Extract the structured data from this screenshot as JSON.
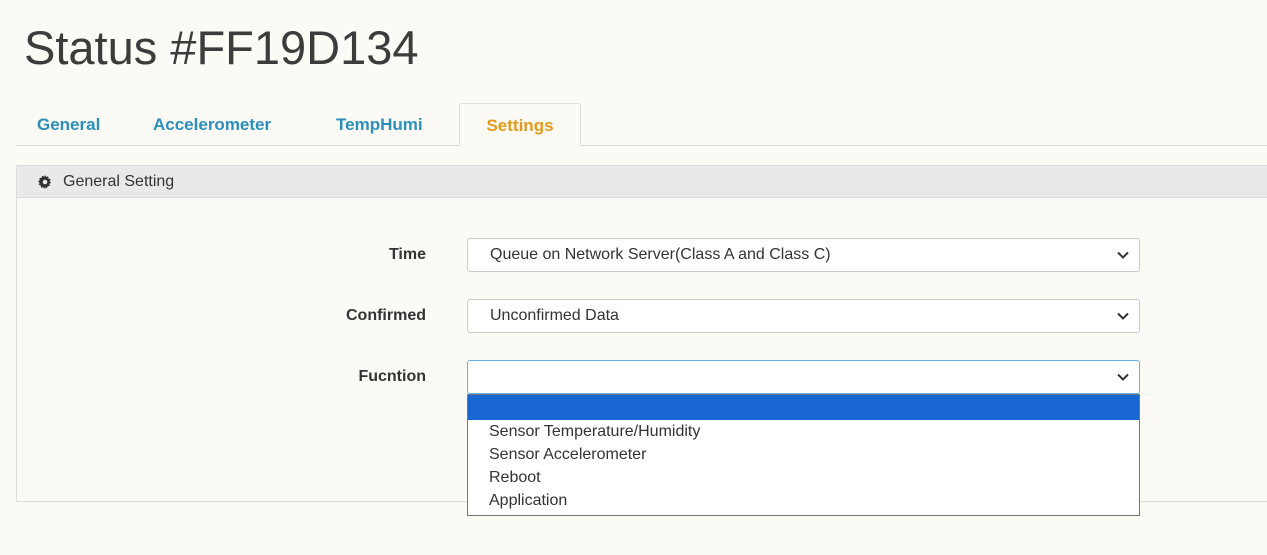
{
  "title": "Status #FF19D134",
  "tabs": {
    "general": "General",
    "accelerometer": "Accelerometer",
    "temphumi": "TempHumi",
    "settings": "Settings"
  },
  "panel": {
    "heading": "General Setting",
    "heading_icon": "gear-icon"
  },
  "fields": {
    "time": {
      "label": "Time",
      "value": "Queue on Network Server(Class A and Class C)"
    },
    "confirmed": {
      "label": "Confirmed",
      "value": "Unconfirmed Data"
    },
    "function": {
      "label": "Fucntion",
      "value": "",
      "options": [
        "",
        "Sensor Temperature/Humidity",
        "Sensor Accelerometer",
        "Reboot",
        "Application"
      ]
    }
  },
  "colors": {
    "tab_link": "#2a8fbd",
    "tab_active": "#e39a1c",
    "option_highlight": "#1967d2",
    "background": "#fbfaf5"
  }
}
